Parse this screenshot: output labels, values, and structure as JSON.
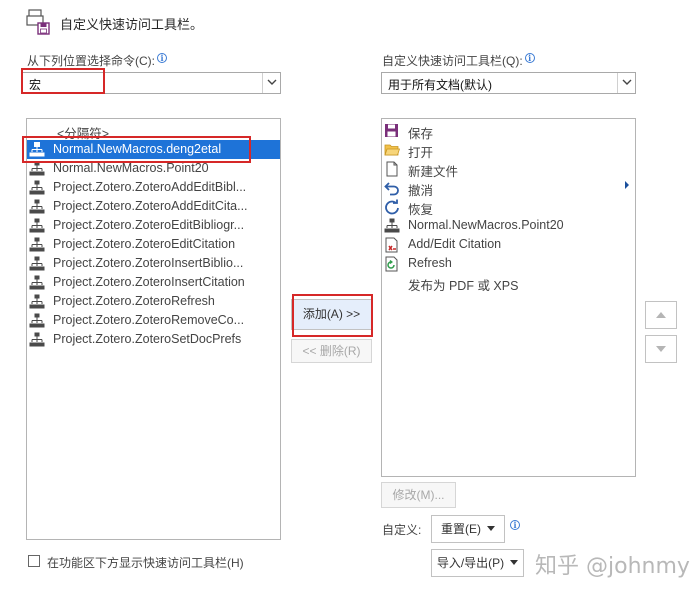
{
  "header": {
    "title": "自定义快速访问工具栏。",
    "icon": "quick-access-toolbar-icon"
  },
  "left": {
    "label": "从下列位置选择命令(C):",
    "source_value": "宏",
    "items": [
      {
        "label": "<分隔符>",
        "icon": "none"
      },
      {
        "label": "Normal.NewMacros.deng2etal",
        "icon": "macro-icon"
      },
      {
        "label": "Normal.NewMacros.Point20",
        "icon": "macro-icon"
      },
      {
        "label": "Project.Zotero.ZoteroAddEditBibl...",
        "icon": "macro-icon"
      },
      {
        "label": "Project.Zotero.ZoteroAddEditCita...",
        "icon": "macro-icon"
      },
      {
        "label": "Project.Zotero.ZoteroEditBibliogr...",
        "icon": "macro-icon"
      },
      {
        "label": "Project.Zotero.ZoteroEditCitation",
        "icon": "macro-icon"
      },
      {
        "label": "Project.Zotero.ZoteroInsertBiblio...",
        "icon": "macro-icon"
      },
      {
        "label": "Project.Zotero.ZoteroInsertCitation",
        "icon": "macro-icon"
      },
      {
        "label": "Project.Zotero.ZoteroRefresh",
        "icon": "macro-icon"
      },
      {
        "label": "Project.Zotero.ZoteroRemoveCo...",
        "icon": "macro-icon"
      },
      {
        "label": "Project.Zotero.ZoteroSetDocPrefs",
        "icon": "macro-icon"
      }
    ],
    "selected_index": 1
  },
  "right": {
    "label": "自定义快速访问工具栏(Q):",
    "target_value": "用于所有文档(默认)",
    "items": [
      {
        "label": "保存",
        "icon": "save-icon"
      },
      {
        "label": "打开",
        "icon": "folder-open-icon"
      },
      {
        "label": "新建文件",
        "icon": "new-file-icon"
      },
      {
        "label": "撤消",
        "icon": "undo-icon"
      },
      {
        "label": "恢复",
        "icon": "redo-icon"
      },
      {
        "label": "Normal.NewMacros.Point20",
        "icon": "macro-icon"
      },
      {
        "label": "Add/Edit Citation",
        "icon": "citation-icon"
      },
      {
        "label": "Refresh",
        "icon": "refresh-icon"
      },
      {
        "label": "发布为 PDF 或 XPS",
        "icon": "none"
      }
    ]
  },
  "buttons": {
    "add": "添加(A) >>",
    "remove": "<< 删除(R)",
    "modify": "修改(M)...",
    "custom_label": "自定义:",
    "reset": "重置(E)",
    "import_export": "导入/导出(P)"
  },
  "bottom": {
    "checkbox_label": "在功能区下方显示快速访问工具栏(H)"
  },
  "watermark": "知乎 @johnmy",
  "colors": {
    "selection": "#1e73d8",
    "highlight_box": "#d62828",
    "info": "#3b7bd4"
  }
}
